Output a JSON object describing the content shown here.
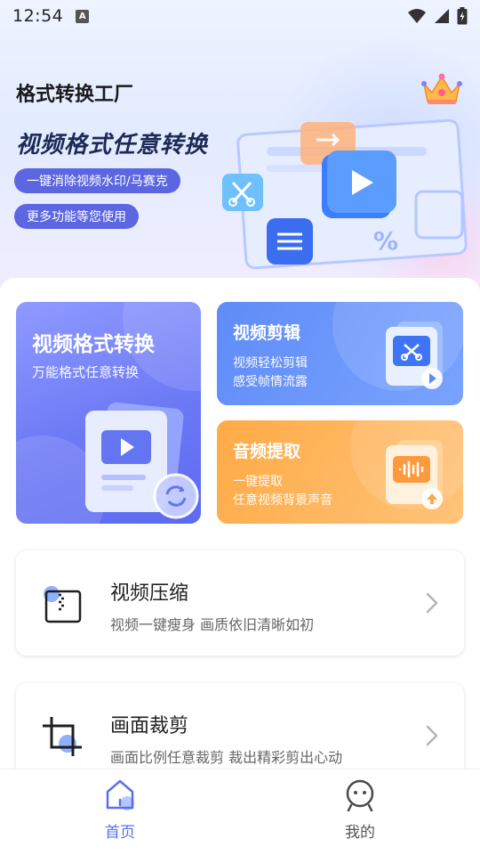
{
  "status_bar": {
    "time": "12:54",
    "indicator": "A"
  },
  "app": {
    "title": "格式转换工厂"
  },
  "banner": {
    "headline": "视频格式任意转换",
    "pill_1": "一键消除视频水印/马赛克",
    "pill_2": "更多功能等您使用"
  },
  "features": {
    "video_convert": {
      "title": "视频格式转换",
      "subtitle": "万能格式任意转换"
    },
    "video_edit": {
      "title": "视频剪辑",
      "line_1": "视频轻松剪辑",
      "line_2": "感受帧情流露"
    },
    "audio_extract": {
      "title": "音频提取",
      "line_1": "一键提取",
      "line_2": "任意视频背景声音"
    }
  },
  "list": {
    "compress": {
      "title": "视频压缩",
      "subtitle": "视频一键瘦身 画质依旧清晰如初"
    },
    "crop": {
      "title": "画面裁剪",
      "subtitle": "画面比例任意裁剪 裁出精彩剪出心动"
    }
  },
  "bottom_nav": {
    "home": {
      "label": "首页",
      "active": true
    },
    "mine": {
      "label": "我的",
      "active": false
    }
  },
  "colors": {
    "accent": "#5a6ff0",
    "pill": "#5b66e0",
    "card_purple": "#6c79f5",
    "card_blue": "#6b97fb",
    "card_orange": "#ffb35e"
  },
  "icons": {
    "status": [
      "wifi-icon",
      "signal-icon",
      "battery-icon"
    ],
    "banner": "crown-icon",
    "features": [
      "play-icon",
      "scissors-icon",
      "waveform-icon"
    ],
    "list": [
      "compress-icon",
      "crop-icon",
      "chevron-right-icon"
    ],
    "nav": [
      "home-icon",
      "profile-icon"
    ]
  }
}
